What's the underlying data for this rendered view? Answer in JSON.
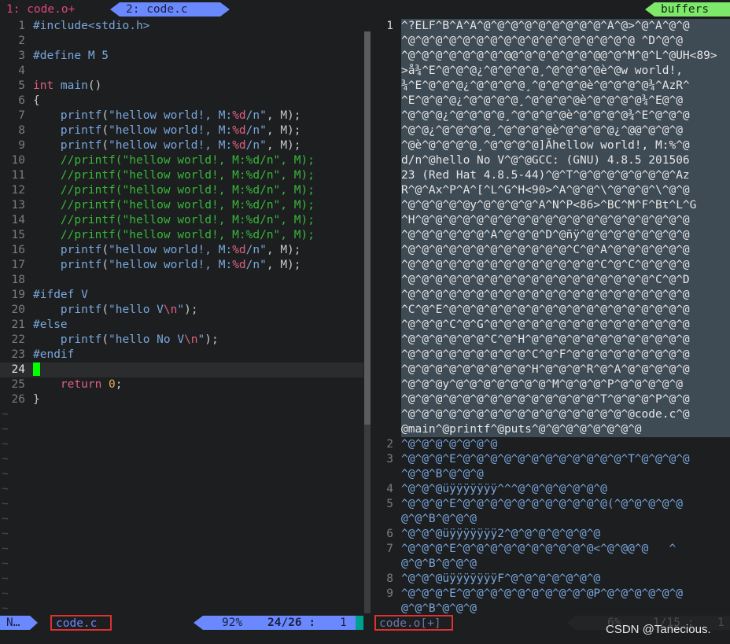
{
  "tabs": {
    "tab1": "1: code.o+",
    "tab2": "2: code.c",
    "buffers": "buffers"
  },
  "left": {
    "lines": [
      {
        "n": "1",
        "segs": [
          [
            "k-pre",
            "#include<stdio.h>"
          ]
        ]
      },
      {
        "n": "2",
        "segs": []
      },
      {
        "n": "3",
        "segs": [
          [
            "k-pre",
            "#define M 5"
          ]
        ]
      },
      {
        "n": "4",
        "segs": []
      },
      {
        "n": "5",
        "segs": [
          [
            "k-type",
            "int "
          ],
          [
            "k-fn",
            "main"
          ],
          [
            "",
            "()"
          ]
        ]
      },
      {
        "n": "6",
        "segs": [
          [
            "",
            "{"
          ]
        ]
      },
      {
        "n": "7",
        "segs": [
          [
            "",
            "    "
          ],
          [
            "k-fn",
            "printf"
          ],
          [
            "",
            "("
          ],
          [
            "k-str",
            "\"hellow world!, M:"
          ],
          [
            "k-fmt",
            "%d"
          ],
          [
            "k-str",
            "/n\""
          ],
          [
            "",
            ", M);"
          ]
        ]
      },
      {
        "n": "8",
        "segs": [
          [
            "",
            "    "
          ],
          [
            "k-fn",
            "printf"
          ],
          [
            "",
            "("
          ],
          [
            "k-str",
            "\"hellow world!, M:"
          ],
          [
            "k-fmt",
            "%d"
          ],
          [
            "k-str",
            "/n\""
          ],
          [
            "",
            ", M);"
          ]
        ]
      },
      {
        "n": "9",
        "segs": [
          [
            "",
            "    "
          ],
          [
            "k-fn",
            "printf"
          ],
          [
            "",
            "("
          ],
          [
            "k-str",
            "\"hellow world!, M:"
          ],
          [
            "k-fmt",
            "%d"
          ],
          [
            "k-str",
            "/n\""
          ],
          [
            "",
            ", M);"
          ]
        ]
      },
      {
        "n": "10",
        "segs": [
          [
            "",
            "    "
          ],
          [
            "k-cmt",
            "//printf(\"hellow world!, M:%d/n\", M);"
          ]
        ]
      },
      {
        "n": "11",
        "segs": [
          [
            "",
            "    "
          ],
          [
            "k-cmt",
            "//printf(\"hellow world!, M:%d/n\", M);"
          ]
        ]
      },
      {
        "n": "12",
        "segs": [
          [
            "",
            "    "
          ],
          [
            "k-cmt",
            "//printf(\"hellow world!, M:%d/n\", M);"
          ]
        ]
      },
      {
        "n": "13",
        "segs": [
          [
            "",
            "    "
          ],
          [
            "k-cmt",
            "//printf(\"hellow world!, M:%d/n\", M);"
          ]
        ]
      },
      {
        "n": "14",
        "segs": [
          [
            "",
            "    "
          ],
          [
            "k-cmt",
            "//printf(\"hellow world!, M:%d/n\", M);"
          ]
        ]
      },
      {
        "n": "15",
        "segs": [
          [
            "",
            "    "
          ],
          [
            "k-cmt",
            "//printf(\"hellow world!, M:%d/n\", M);"
          ]
        ]
      },
      {
        "n": "16",
        "segs": [
          [
            "",
            "    "
          ],
          [
            "k-fn",
            "printf"
          ],
          [
            "",
            "("
          ],
          [
            "k-str",
            "\"hellow world!, M:"
          ],
          [
            "k-fmt",
            "%d"
          ],
          [
            "k-str",
            "/n\""
          ],
          [
            "",
            ", M);"
          ]
        ]
      },
      {
        "n": "17",
        "segs": [
          [
            "",
            "    "
          ],
          [
            "k-fn",
            "printf"
          ],
          [
            "",
            "("
          ],
          [
            "k-str",
            "\"hellow world!, M:"
          ],
          [
            "k-fmt",
            "%d"
          ],
          [
            "k-str",
            "/n\""
          ],
          [
            "",
            ", M);"
          ]
        ]
      },
      {
        "n": "18",
        "segs": []
      },
      {
        "n": "19",
        "segs": [
          [
            "k-pre",
            "#ifdef V"
          ]
        ]
      },
      {
        "n": "20",
        "segs": [
          [
            "",
            "    "
          ],
          [
            "k-fn",
            "printf"
          ],
          [
            "",
            "("
          ],
          [
            "k-str",
            "\"hello V"
          ],
          [
            "k-fmt",
            "\\n"
          ],
          [
            "k-str",
            "\""
          ],
          [
            "",
            ");"
          ]
        ]
      },
      {
        "n": "21",
        "segs": [
          [
            "k-pre",
            "#else"
          ]
        ]
      },
      {
        "n": "22",
        "segs": [
          [
            "",
            "    "
          ],
          [
            "k-fn",
            "printf"
          ],
          [
            "",
            "("
          ],
          [
            "k-str",
            "\"hello No V"
          ],
          [
            "k-fmt",
            "\\n"
          ],
          [
            "k-str",
            "\""
          ],
          [
            "",
            ");"
          ]
        ]
      },
      {
        "n": "23",
        "segs": [
          [
            "k-pre",
            "#endif"
          ]
        ]
      },
      {
        "n": "24",
        "segs": [],
        "cursor": true
      },
      {
        "n": "25",
        "segs": [
          [
            "",
            "    "
          ],
          [
            "k-type",
            "return "
          ],
          [
            "k-num",
            "0"
          ],
          [
            "",
            ";"
          ]
        ]
      },
      {
        "n": "26",
        "segs": [
          [
            "",
            "}"
          ]
        ]
      }
    ],
    "tilde": "~",
    "tilde_count": 14
  },
  "right": {
    "lines": [
      {
        "n": "1",
        "sel": true,
        "t": "^?ELF^B^A^A^@^@^@^@^@^@^@^@^@^A^@>^@^A^@^@"
      },
      {
        "n": "",
        "sel": true,
        "t": "^@^@^@^@^@^@^@^@^@^@^@^@^@^@^@^@^@ ^D^@^@"
      },
      {
        "n": "",
        "sel": true,
        "t": "^@^@^@^@^@^@^@^@@^@^@^@^@^@^@@^@^M^@^L^@UH<89>"
      },
      {
        "n": "",
        "sel": true,
        "t": ">å¾^E^@^@^@¿^@^@^@^@¸^@^@^@^@è^@w world!,"
      },
      {
        "n": "",
        "sel": true,
        "t": "¾^E^@^@^@¿^@^@^@^@¸^@^@^@^@è^@^@^@^@¾^AzR^"
      },
      {
        "n": "",
        "sel": true,
        "t": "^E^@^@^@¿^@^@^@^@¸^@^@^@^@è^@^@^@^@¾^E@^@"
      },
      {
        "n": "",
        "sel": true,
        "t": "^@^@^@¿^@^@^@^@¸^@^@^@^@è^@^@^@^@¾^E^@^@^@"
      },
      {
        "n": "",
        "sel": true,
        "t": "^@^@¿^@^@^@^@¸^@^@^@^@è^@^@^@^@¿^@@^@^@^@"
      },
      {
        "n": "",
        "sel": true,
        "t": "^@è^@^@^@^@¸^@^@^@^@]Ãhellow world!, M:%^@"
      },
      {
        "n": "",
        "sel": true,
        "t": "d/n^@hello No V^@^@GCC: (GNU) 4.8.5 201506"
      },
      {
        "n": "",
        "sel": true,
        "t": "23 (Red Hat 4.8.5-44)^@^T^@^@^@^@^@^@^@^Az"
      },
      {
        "n": "",
        "sel": true,
        "t": "R^@^Ax^P^A^[^L^G^H<90>^A^@^@^\\^@^@^@^\\^@^@"
      },
      {
        "n": "",
        "sel": true,
        "t": "^@^@^@^@^@y^@^@^@^@^A^N^P<86>^BC^M^F^Bt^L^G"
      },
      {
        "n": "",
        "sel": true,
        "t": "^H^@^@^@^@^@^@^@^@^@^@^@^@^@^@^@^@^@^@^@^@"
      },
      {
        "n": "",
        "sel": true,
        "t": "^@^@^@^@^@^@^A^@^@^@^D^@ñÿ^@^@^@^@^@^@^@^@"
      },
      {
        "n": "",
        "sel": true,
        "t": "^@^@^@^@^@^@^@^@^@^@^@^@^C^@^A^@^@^@^@^@^@"
      },
      {
        "n": "",
        "sel": true,
        "t": "^@^@^@^@^@^@^@^@^@^@^@^@^@^@^C^@^C^@^@^@^@"
      },
      {
        "n": "",
        "sel": true,
        "t": "^@^@^@^@^@^@^@^@^@^@^@^@^@^@^@^@^@^@^C^@^D"
      },
      {
        "n": "",
        "sel": true,
        "t": "^@^@^@^@^@^@^@^@^@^@^@^@^@^@^@^@^@^@^@^@^@"
      },
      {
        "n": "",
        "sel": true,
        "t": "^C^@^E^@^@^@^@^@^@^@^@^@^@^@^@^@^@^@^@^@^@"
      },
      {
        "n": "",
        "sel": true,
        "t": "^@^@^@^C^@^G^@^@^@^@^@^@^@^@^@^@^@^@^@^@^@"
      },
      {
        "n": "",
        "sel": true,
        "t": "^@^@^@^@^@^@^C^@^H^@^@^@^@^@^@^@^@^@^@^@^@"
      },
      {
        "n": "",
        "sel": true,
        "t": "^@^@^@^@^@^@^@^@^@^C^@^F^@^@^@^@^@^@^@^@^@"
      },
      {
        "n": "",
        "sel": true,
        "t": "^@^@^@^@^@^@^@^@^@^H^@^@^@^R^@^A^@^@^@^@^@"
      },
      {
        "n": "",
        "sel": true,
        "t": "^@^@^@y^@^@^@^@^@^@^@^M^@^@^@^P^@^@^@^@^@"
      },
      {
        "n": "",
        "sel": true,
        "t": "^@^@^@^@^@^@^@^@^@^@^@^@^@^@^T^@^@^@^P^@^@"
      },
      {
        "n": "",
        "sel": true,
        "t": "^@^@^@^@^@^@^@^@^@^@^@^@^@^@^@^@^@code.c^@"
      },
      {
        "n": "",
        "sel": true,
        "t": "@main^@printf^@puts^@^@^@^@^@^@^@^@"
      },
      {
        "n": "2",
        "sel": false,
        "t": "^@^@^@^@^@^@^@"
      },
      {
        "n": "3",
        "sel": false,
        "t": "^@^@^@^E^@^@^@^@^@^@^@^@^@^@^@^@^T^@^@^@^@"
      },
      {
        "n": "",
        "sel": false,
        "t": "^@^@^B^@^@^@"
      },
      {
        "n": "4",
        "sel": false,
        "t": "^@^@^@üÿÿÿÿÿÿÿ^^^@^@^@^@^@^@^@"
      },
      {
        "n": "5",
        "sel": false,
        "t": "^@^@^@^E^@^@^@^@^@^@^@^@^@^@^@(^@^@^@^@^@"
      },
      {
        "n": "",
        "sel": false,
        "t": "@^@^B^@^@^@"
      },
      {
        "n": "6",
        "sel": false,
        "t": "^@^@^@üÿÿÿÿÿÿÿ2^@^@^@^@^@^@^@"
      },
      {
        "n": "7",
        "sel": false,
        "t": "^@^@^@^E^@^@^@^@^@^@^@^@^@^@<^@^@@^@   ^"
      },
      {
        "n": "",
        "sel": false,
        "t": "@^@^B^@^@^@"
      },
      {
        "n": "8",
        "sel": false,
        "t": "^@^@^@üÿÿÿÿÿÿÿF^@^@^@^@^@^@^@"
      },
      {
        "n": "9",
        "sel": false,
        "t": "^@^@^@^E^@^@^@^@^@^@^@^@^@^@P^@^@^@^@^@^@"
      },
      {
        "n": "",
        "sel": false,
        "t": "@^@^B^@^@^@"
      }
    ]
  },
  "status": {
    "mode": "N…",
    "left_file": "code.c",
    "percent": "92%",
    "line_total": "24/26 :",
    "col": "1",
    "right_file": "code.o[+]",
    "right_percent": "6%",
    "right_lines": "1/15 :",
    "right_col": "1"
  },
  "watermark": "CSDN @Tanecious."
}
